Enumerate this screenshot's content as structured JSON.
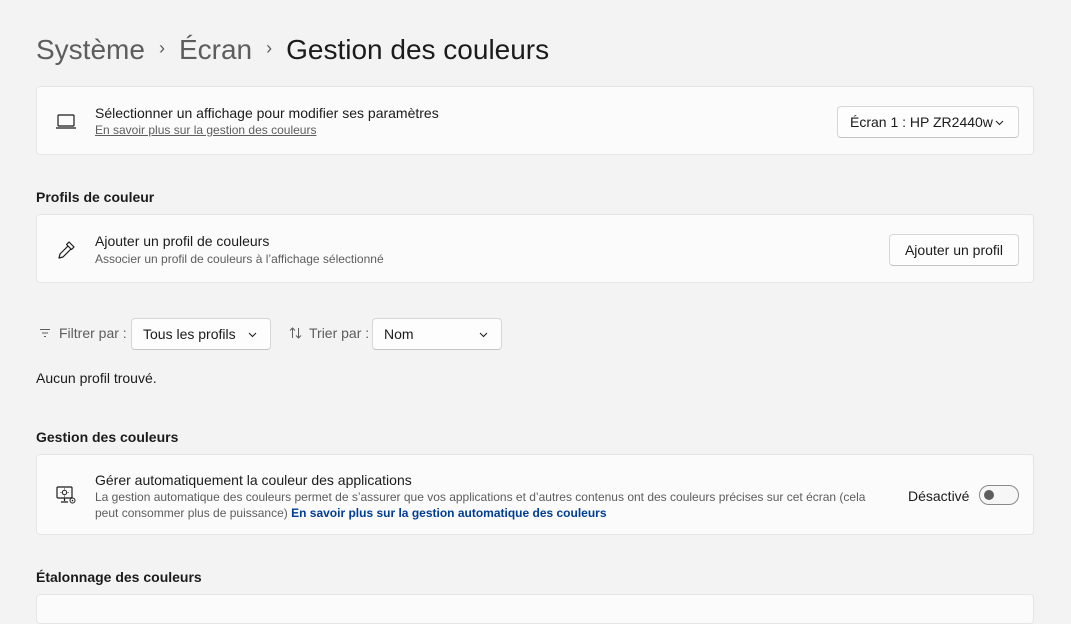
{
  "breadcrumb": {
    "items": [
      "Système",
      "Écran"
    ],
    "current": "Gestion des couleurs"
  },
  "display_card": {
    "title": "Sélectionner un affichage pour modifier ses paramètres",
    "link": "En savoir plus sur la gestion des couleurs",
    "dropdown_value": "Écran 1 : HP ZR2440w",
    "icon": "laptop-icon"
  },
  "profiles_section": {
    "heading": "Profils de couleur",
    "card": {
      "title": "Ajouter un profil de couleurs",
      "description": "Associer un profil de couleurs à l’affichage sélectionné",
      "button_label": "Ajouter un profil",
      "icon": "eyedropper-icon"
    },
    "filter_label": "Filtrer par :",
    "filter_value": "Tous les profils",
    "sort_label": "Trier par :",
    "sort_value": "Nom",
    "empty_message": "Aucun profil trouvé."
  },
  "color_management_section": {
    "heading": "Gestion des couleurs",
    "card": {
      "title": "Gérer automatiquement la couleur des applications",
      "description_line1": "La gestion automatique des couleurs permet de s’assurer que vos applications et d’autres contenus ont des couleurs précises sur cet écran (cela",
      "description_line2": "peut consommer plus de puissance)",
      "link": "En savoir plus sur la gestion automatique des couleurs",
      "toggle_state_label": "Désactivé",
      "toggle_on": false,
      "icon": "display-color-settings-icon"
    }
  },
  "calibration_section": {
    "heading": "Étalonnage des couleurs"
  },
  "colors": {
    "accent_link": "#003e92",
    "background": "#f3f3f3",
    "card": "#fbfbfb"
  }
}
